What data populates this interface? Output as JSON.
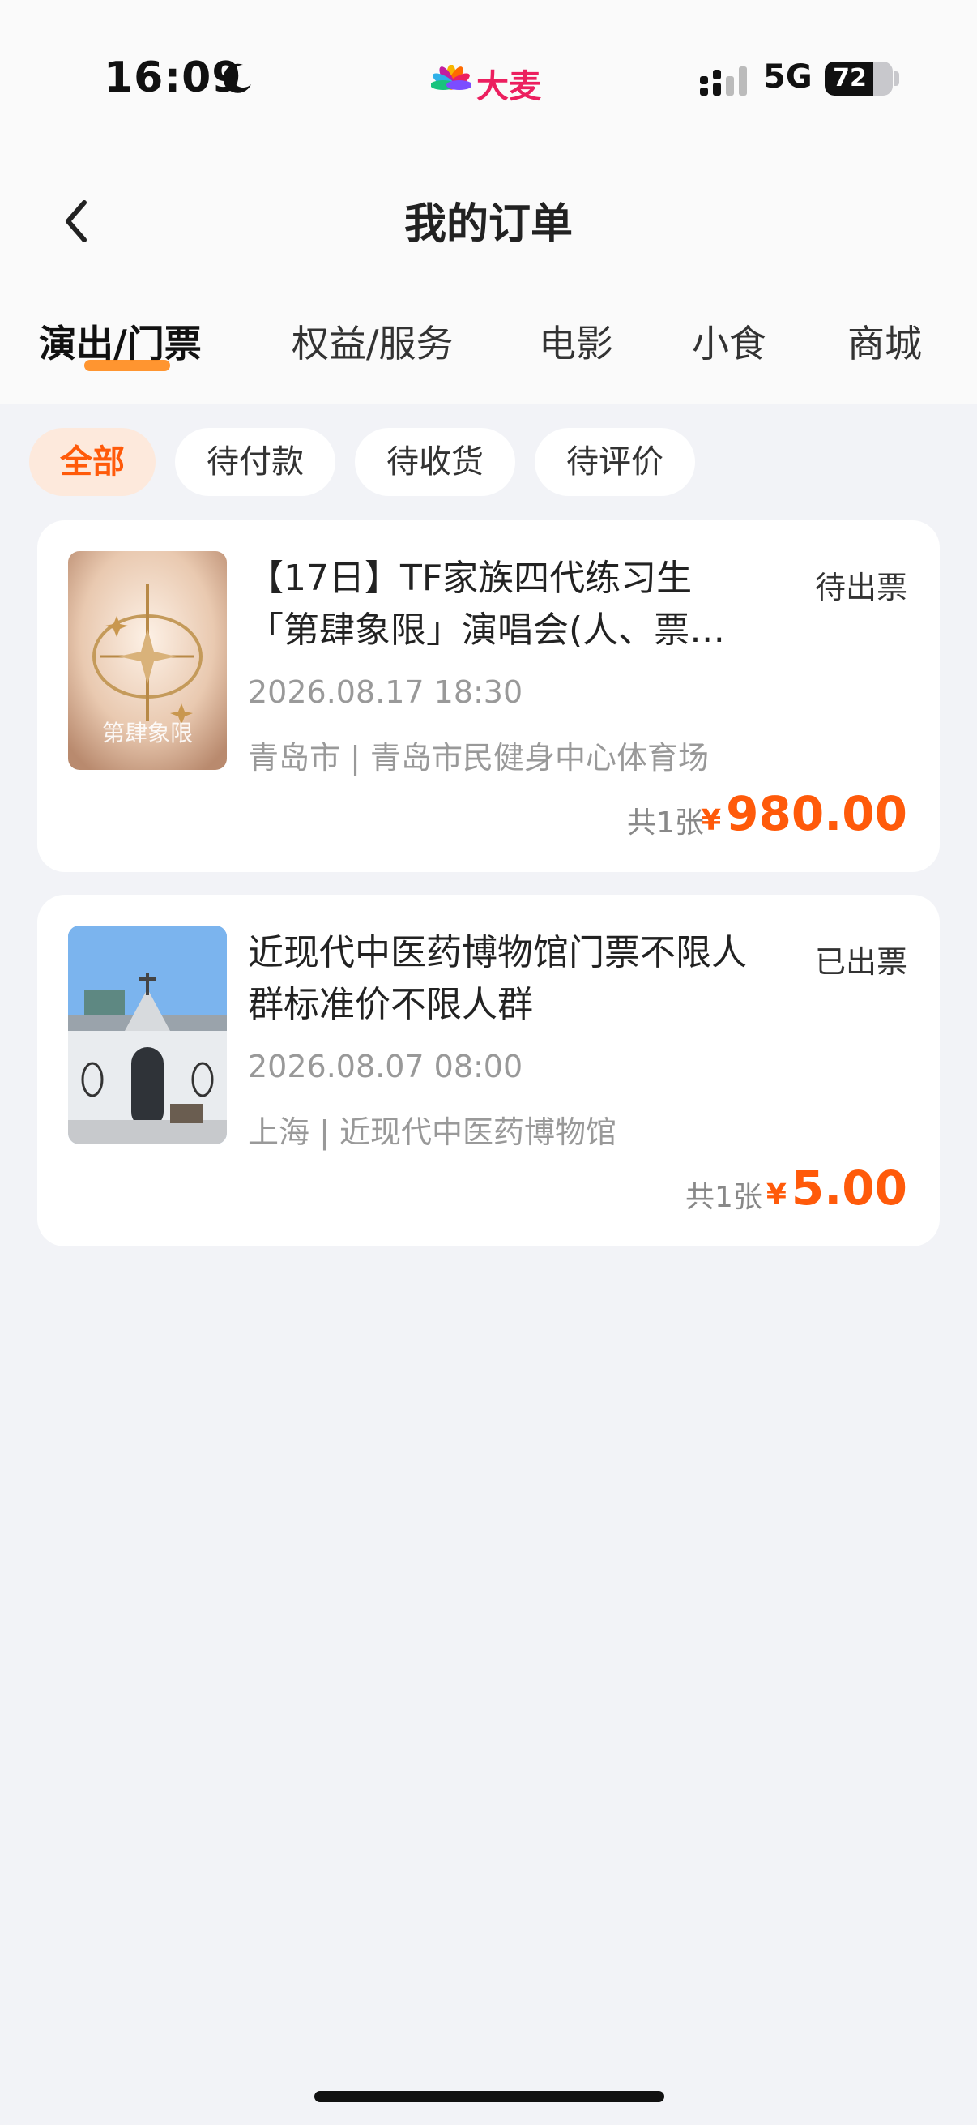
{
  "status_bar": {
    "time": "16:09",
    "network": "5G",
    "battery_level": "72",
    "battery_fraction": 0.72
  },
  "brand": {
    "name": "大麦",
    "color": "#ec1f5f"
  },
  "nav": {
    "title": "我的订单",
    "back_icon": "chevron-left-icon"
  },
  "tabs": [
    {
      "label": "演出/门票",
      "active": true
    },
    {
      "label": "权益/服务",
      "active": false
    },
    {
      "label": "电影",
      "active": false
    },
    {
      "label": "小食",
      "active": false
    },
    {
      "label": "商城",
      "active": false
    }
  ],
  "filters": [
    {
      "label": "全部",
      "active": true
    },
    {
      "label": "待付款",
      "active": false
    },
    {
      "label": "待收货",
      "active": false
    },
    {
      "label": "待评价",
      "active": false
    }
  ],
  "orders": [
    {
      "title_line1": "【17日】TF家族四代练习生",
      "title_line2": "「第肆象限」演唱会(人、票…",
      "status": "待出票",
      "datetime": "2026.08.17 18:30",
      "venue": "青岛市 | 青岛市民健身中心体育场",
      "count": "共1张",
      "currency": "¥",
      "price": "980.00",
      "poster_text": "第肆象限"
    },
    {
      "title_line1": "近现代中医药博物馆门票不限人",
      "title_line2": "群标准价不限人群",
      "status": "已出票",
      "datetime": "2026.08.07 08:00",
      "venue": "上海 | 近现代中医药博物馆",
      "count": "共1张",
      "currency": "¥",
      "price": "5.00"
    }
  ],
  "colors": {
    "accent": "#ff5a0a",
    "tab_underline": "#ff8a1a",
    "background": "#f2f3f7"
  }
}
